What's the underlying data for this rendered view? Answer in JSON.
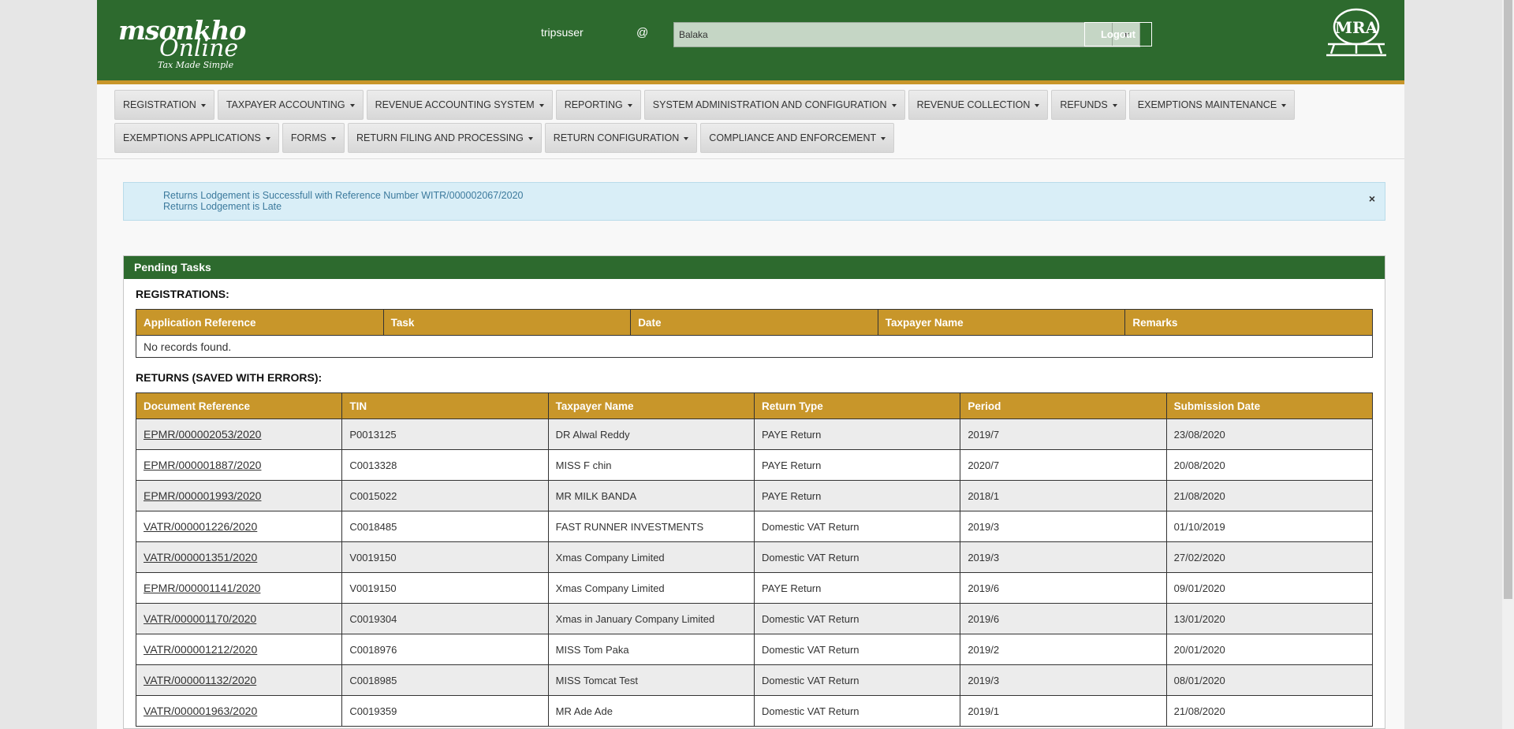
{
  "header": {
    "logo_line1": "msonkho",
    "logo_line2": "Online",
    "logo_tagline": "Tax Made Simple",
    "username": "tripsuser",
    "at_symbol": "@",
    "branch_selected": "Balaka",
    "logout_label": "Logout",
    "mra_logo_text": "MRA",
    "colors": {
      "header_bg": "#2d6a2e",
      "accent": "#c8962a"
    }
  },
  "nav": {
    "row1": [
      "REGISTRATION",
      "TAXPAYER ACCOUNTING",
      "REVENUE ACCOUNTING SYSTEM",
      "REPORTING",
      "SYSTEM ADMINISTRATION AND CONFIGURATION",
      "REVENUE COLLECTION",
      "REFUNDS",
      "EXEMPTIONS MAINTENANCE"
    ],
    "row2": [
      "EXEMPTIONS APPLICATIONS",
      "FORMS",
      "RETURN FILING AND PROCESSING",
      "RETURN CONFIGURATION",
      "COMPLIANCE AND ENFORCEMENT"
    ]
  },
  "alert": {
    "line1": "Returns Lodgement is Successfull with Reference Number WITR/000002067/2020",
    "line2": "Returns Lodgement is Late",
    "close_label": "×"
  },
  "panel": {
    "title": "Pending Tasks",
    "registrations": {
      "title": "REGISTRATIONS:",
      "headers": [
        "Application Reference",
        "Task",
        "Date",
        "Taxpayer Name",
        "Remarks"
      ],
      "empty_text": "No records found."
    },
    "returns": {
      "title": "RETURNS (SAVED WITH ERRORS):",
      "headers": [
        "Document Reference",
        "TIN",
        "Taxpayer Name",
        "Return Type",
        "Period",
        "Submission Date"
      ],
      "rows": [
        [
          "EPMR/000002053/2020",
          "P0013125",
          "DR Alwal Reddy",
          "PAYE Return",
          "2019/7",
          "23/08/2020"
        ],
        [
          "EPMR/000001887/2020",
          "C0013328",
          "MISS F chin",
          "PAYE Return",
          "2020/7",
          "20/08/2020"
        ],
        [
          "EPMR/000001993/2020",
          "C0015022",
          "MR MILK BANDA",
          "PAYE Return",
          "2018/1",
          "21/08/2020"
        ],
        [
          "VATR/000001226/2020",
          "C0018485",
          "FAST RUNNER INVESTMENTS",
          "Domestic VAT Return",
          "2019/3",
          "01/10/2019"
        ],
        [
          "VATR/000001351/2020",
          "V0019150",
          "Xmas Company Limited",
          "Domestic VAT Return",
          "2019/3",
          "27/02/2020"
        ],
        [
          "EPMR/000001141/2020",
          "V0019150",
          "Xmas Company Limited",
          "PAYE Return",
          "2019/6",
          "09/01/2020"
        ],
        [
          "VATR/000001170/2020",
          "C0019304",
          "Xmas in January Company Limited",
          "Domestic VAT Return",
          "2019/6",
          "13/01/2020"
        ],
        [
          "VATR/000001212/2020",
          "C0018976",
          "MISS Tom Paka",
          "Domestic VAT Return",
          "2019/2",
          "20/01/2020"
        ],
        [
          "VATR/000001132/2020",
          "C0018985",
          "MISS Tomcat Test",
          "Domestic VAT Return",
          "2019/3",
          "08/01/2020"
        ],
        [
          "VATR/000001963/2020",
          "C0019359",
          "MR Ade Ade",
          "Domestic VAT Return",
          "2019/1",
          "21/08/2020"
        ]
      ]
    }
  }
}
